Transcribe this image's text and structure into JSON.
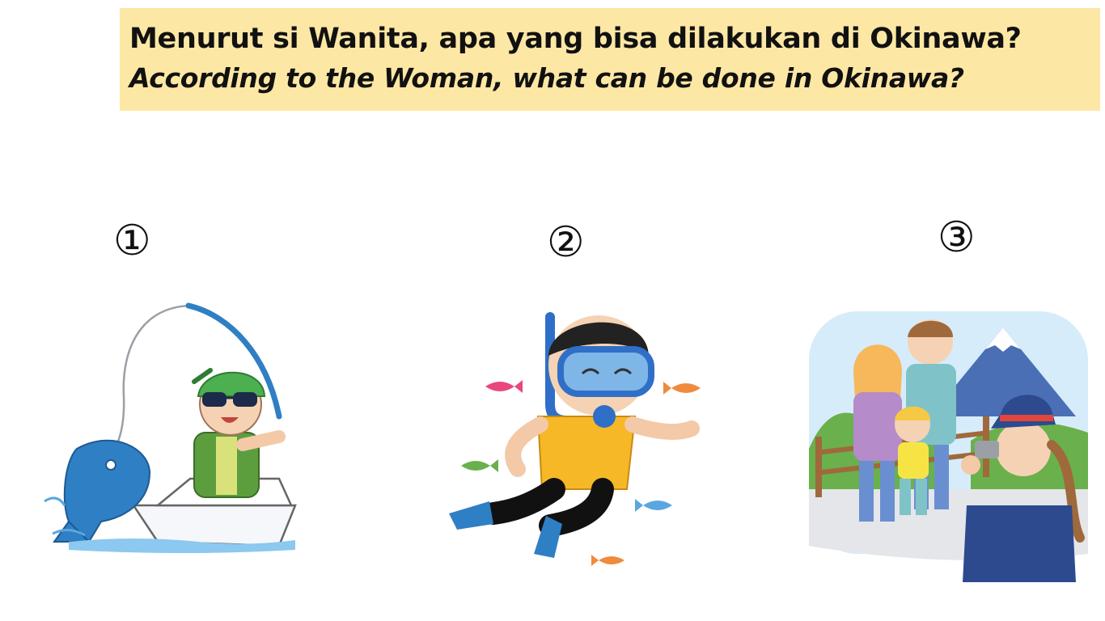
{
  "question": {
    "primary": "Menurut si Wanita, apa yang bisa dilakukan di Okinawa?",
    "secondary": "According to the Woman, what can be done in Okinawa?"
  },
  "options": [
    {
      "number": "①",
      "illustration": "fishing-boat-illustration"
    },
    {
      "number": "②",
      "illustration": "snorkeling-diver-illustration"
    },
    {
      "number": "③",
      "illustration": "sightseeing-family-illustration"
    }
  ],
  "colors": {
    "banner": "#fde7a4",
    "fish": "#2f7fc4",
    "cap": "#4caf50",
    "vest_green": "#5c9e3e",
    "vest_yellow": "#f6b827",
    "mask_blue": "#2f6fc7",
    "mountain": "#4a6fb5",
    "hat_navy": "#2d4a8f"
  }
}
